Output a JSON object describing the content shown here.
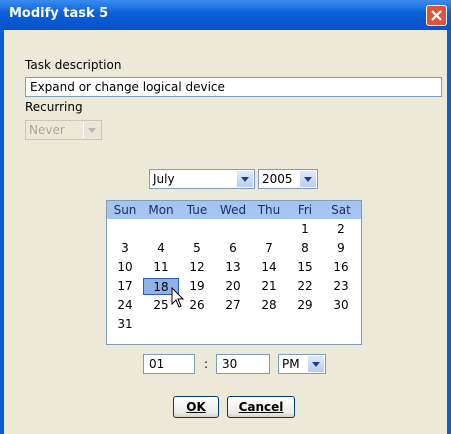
{
  "window": {
    "title": "Modify task 5"
  },
  "description": {
    "label": "Task description",
    "value": "Expand or change logical device"
  },
  "recurring": {
    "label": "Recurring",
    "value": "Never"
  },
  "calendar": {
    "month": "July",
    "year": "2005",
    "day_headers": [
      "Sun",
      "Mon",
      "Tue",
      "Wed",
      "Thu",
      "Fri",
      "Sat"
    ],
    "weeks": [
      [
        "",
        "",
        "",
        "",
        "",
        "1",
        "2"
      ],
      [
        "3",
        "4",
        "5",
        "6",
        "7",
        "8",
        "9"
      ],
      [
        "10",
        "11",
        "12",
        "13",
        "14",
        "15",
        "16"
      ],
      [
        "17",
        "18",
        "19",
        "20",
        "21",
        "22",
        "23"
      ],
      [
        "24",
        "25",
        "26",
        "27",
        "28",
        "29",
        "30"
      ],
      [
        "31",
        "",
        "",
        "",
        "",
        "",
        ""
      ]
    ],
    "selected_day": "18"
  },
  "time": {
    "hour": "01",
    "separator": ":",
    "minute": "30",
    "ampm": "PM"
  },
  "buttons": {
    "ok_label": "OK",
    "cancel_label": "Cancel"
  },
  "colors": {
    "titlebar": "#0a5fd8",
    "selection": "#8fb2ea",
    "header": "#a5c4ef"
  }
}
